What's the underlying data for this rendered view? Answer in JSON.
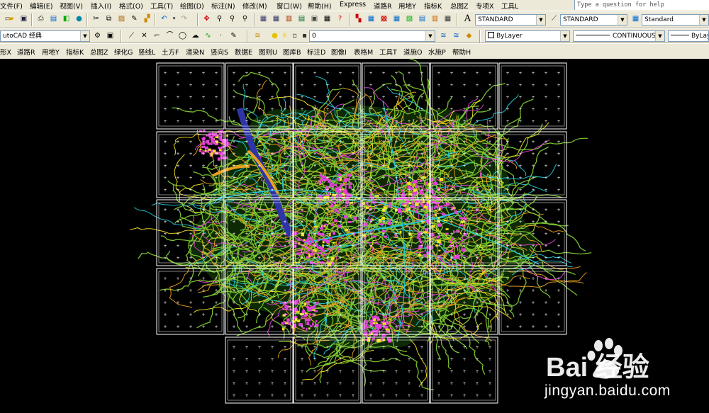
{
  "menubar": {
    "items": [
      "文件(F)",
      "编辑(E)",
      "视图(V)",
      "插入(I)",
      "格式(O)",
      "工具(T)",
      "绘图(D)",
      "标注(N)",
      "修改(M)",
      "窗口(W)",
      "帮助(H)",
      "Express",
      "道路R",
      "用地Y",
      "指标K",
      "总图Z",
      "专项X",
      "工具L"
    ],
    "help_placeholder": "Type a question for help"
  },
  "toolbar1": {
    "text_style": "STANDARD",
    "dim_style": "STANDARD",
    "table_style": "Standard"
  },
  "toolbar2": {
    "workspace": "utoCAD 经典",
    "layer": "0",
    "color": "ByLayer",
    "linetype": "CONTINUOUS",
    "lineweight": "ByLayer"
  },
  "plugin_menu": {
    "items": [
      "形X",
      "道路R",
      "用地Y",
      "指标K",
      "总图Z",
      "绿化G",
      "竖线L",
      "土方F",
      "渲染N",
      "竖向S",
      "数据E",
      "图则U",
      "图库B",
      "标注D",
      "图像I",
      "表格M",
      "工具T",
      "道施O",
      "水施P",
      "帮助H"
    ]
  },
  "drawing": {
    "background": "#000000",
    "sheet_border_color": "#ffffff",
    "contour_colors": [
      "#7ec832",
      "#e8a020",
      "#e040d8",
      "#22c8d8",
      "#f0e020",
      "#2f34a8"
    ]
  },
  "watermark": {
    "brand": "Bai 经验",
    "url": "jingyan.baidu.com"
  }
}
